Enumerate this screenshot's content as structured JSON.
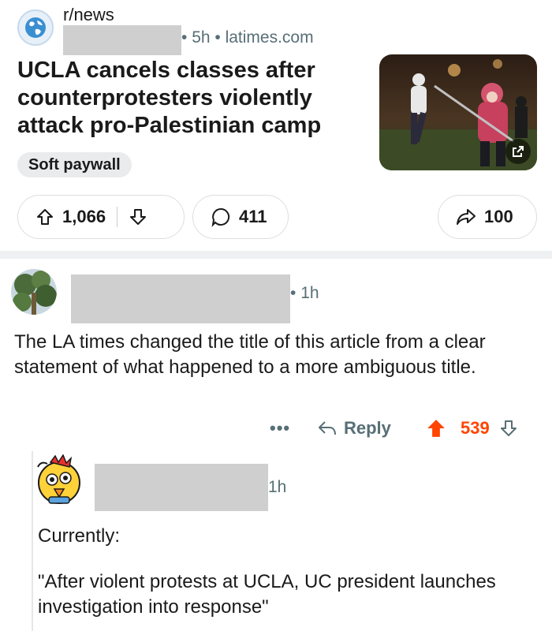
{
  "post": {
    "subreddit": "r/news",
    "time": "5h",
    "domain": "latimes.com",
    "title": "UCLA cancels classes after counterprotesters violently attack pro-Palestinian camp",
    "flair": "Soft paywall",
    "upvotes": "1,066",
    "comments": "411",
    "shares": "100"
  },
  "comments": [
    {
      "time": "1h",
      "body": "The LA times changed the title of this article from a clear statement of what happened to a more ambiguous title.",
      "more": "•••",
      "reply_label": "Reply",
      "score": "539"
    },
    {
      "time": "1h",
      "body_line1": "Currently:",
      "body_line2": "\"After violent protests at UCLA, UC president launches investigation into response\""
    }
  ],
  "colors": {
    "upvoted": "#ff4500",
    "meta_text": "#576f76",
    "pill_border": "#dcdee0",
    "flair_bg": "#e9ebed",
    "divider": "#eef0f2"
  },
  "icons": [
    "globe-icon",
    "external-link-icon",
    "upvote-icon",
    "downvote-icon",
    "comment-icon",
    "share-icon",
    "reply-icon",
    "upvote-filled-icon"
  ]
}
